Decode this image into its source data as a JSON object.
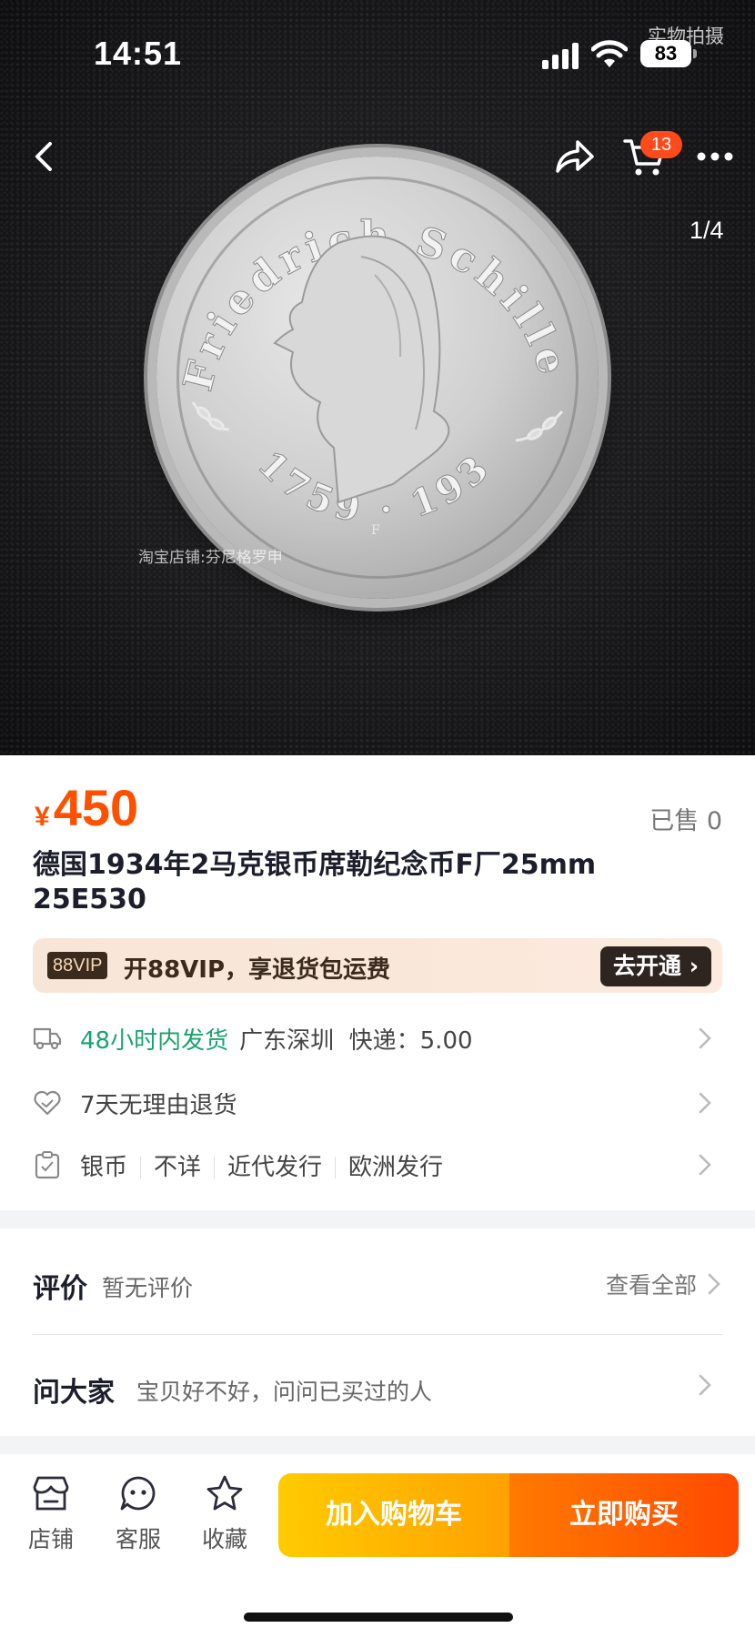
{
  "status": {
    "time": "14:51",
    "battery": "83",
    "photo_tag": "实物拍摄"
  },
  "header": {
    "cart_count": "13",
    "pager": "1/4"
  },
  "image": {
    "watermark": "淘宝店铺:芬尼格罗申",
    "coin_legend_top": "Friedrich Schiller",
    "coin_legend_bottom": "1759 · 1934",
    "mint_mark": "F"
  },
  "product": {
    "currency": "¥",
    "price": "450",
    "sold": "已售 0",
    "title": "德国1934年2马克银币席勒纪念币F厂25mm 25E530"
  },
  "vip": {
    "badge": "88VIP",
    "text": "开88VIP，享退货包运费",
    "button": "去开通"
  },
  "rows": {
    "shipping": {
      "highlight": "48小时内发货",
      "location": "广东深圳",
      "fee": "快递：5.00"
    },
    "returns": {
      "label": "7天无理由退货"
    },
    "attrs": [
      "银币",
      "不详",
      "近代发行",
      "欧洲发行"
    ]
  },
  "reviews": {
    "label": "评价",
    "sub": "暂无评价",
    "link": "查看全部"
  },
  "ask": {
    "label": "问大家",
    "sub": "宝贝好不好，问问已买过的人"
  },
  "bottom": {
    "store": "店铺",
    "service": "客服",
    "favorite": "收藏",
    "add_to_cart": "加入购物车",
    "buy_now": "立即购买"
  },
  "colors": {
    "accent": "#ff5000",
    "green": "#1aa36f",
    "cart_gradient": "#ffcb00",
    "buy_gradient": "#ff4a00"
  }
}
